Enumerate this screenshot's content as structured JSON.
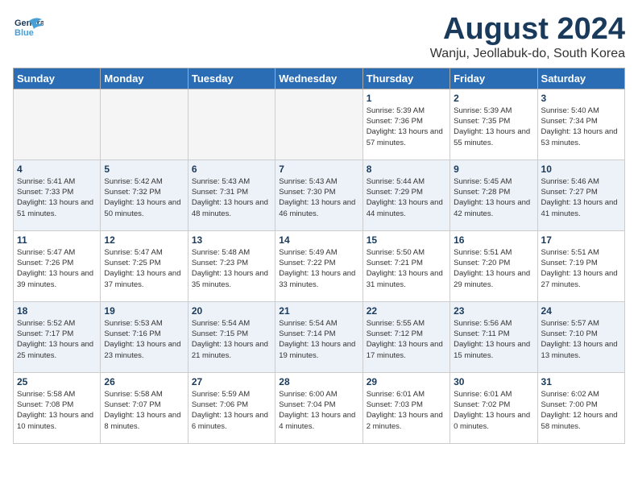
{
  "header": {
    "logo_general": "General",
    "logo_blue": "Blue",
    "month_title": "August 2024",
    "location": "Wanju, Jeollabuk-do, South Korea"
  },
  "weekdays": [
    "Sunday",
    "Monday",
    "Tuesday",
    "Wednesday",
    "Thursday",
    "Friday",
    "Saturday"
  ],
  "weeks": [
    [
      {
        "day": "",
        "empty": true
      },
      {
        "day": "",
        "empty": true
      },
      {
        "day": "",
        "empty": true
      },
      {
        "day": "",
        "empty": true
      },
      {
        "day": "1",
        "sunrise": "Sunrise: 5:39 AM",
        "sunset": "Sunset: 7:36 PM",
        "daylight": "Daylight: 13 hours and 57 minutes."
      },
      {
        "day": "2",
        "sunrise": "Sunrise: 5:39 AM",
        "sunset": "Sunset: 7:35 PM",
        "daylight": "Daylight: 13 hours and 55 minutes."
      },
      {
        "day": "3",
        "sunrise": "Sunrise: 5:40 AM",
        "sunset": "Sunset: 7:34 PM",
        "daylight": "Daylight: 13 hours and 53 minutes."
      }
    ],
    [
      {
        "day": "4",
        "sunrise": "Sunrise: 5:41 AM",
        "sunset": "Sunset: 7:33 PM",
        "daylight": "Daylight: 13 hours and 51 minutes."
      },
      {
        "day": "5",
        "sunrise": "Sunrise: 5:42 AM",
        "sunset": "Sunset: 7:32 PM",
        "daylight": "Daylight: 13 hours and 50 minutes."
      },
      {
        "day": "6",
        "sunrise": "Sunrise: 5:43 AM",
        "sunset": "Sunset: 7:31 PM",
        "daylight": "Daylight: 13 hours and 48 minutes."
      },
      {
        "day": "7",
        "sunrise": "Sunrise: 5:43 AM",
        "sunset": "Sunset: 7:30 PM",
        "daylight": "Daylight: 13 hours and 46 minutes."
      },
      {
        "day": "8",
        "sunrise": "Sunrise: 5:44 AM",
        "sunset": "Sunset: 7:29 PM",
        "daylight": "Daylight: 13 hours and 44 minutes."
      },
      {
        "day": "9",
        "sunrise": "Sunrise: 5:45 AM",
        "sunset": "Sunset: 7:28 PM",
        "daylight": "Daylight: 13 hours and 42 minutes."
      },
      {
        "day": "10",
        "sunrise": "Sunrise: 5:46 AM",
        "sunset": "Sunset: 7:27 PM",
        "daylight": "Daylight: 13 hours and 41 minutes."
      }
    ],
    [
      {
        "day": "11",
        "sunrise": "Sunrise: 5:47 AM",
        "sunset": "Sunset: 7:26 PM",
        "daylight": "Daylight: 13 hours and 39 minutes."
      },
      {
        "day": "12",
        "sunrise": "Sunrise: 5:47 AM",
        "sunset": "Sunset: 7:25 PM",
        "daylight": "Daylight: 13 hours and 37 minutes."
      },
      {
        "day": "13",
        "sunrise": "Sunrise: 5:48 AM",
        "sunset": "Sunset: 7:23 PM",
        "daylight": "Daylight: 13 hours and 35 minutes."
      },
      {
        "day": "14",
        "sunrise": "Sunrise: 5:49 AM",
        "sunset": "Sunset: 7:22 PM",
        "daylight": "Daylight: 13 hours and 33 minutes."
      },
      {
        "day": "15",
        "sunrise": "Sunrise: 5:50 AM",
        "sunset": "Sunset: 7:21 PM",
        "daylight": "Daylight: 13 hours and 31 minutes."
      },
      {
        "day": "16",
        "sunrise": "Sunrise: 5:51 AM",
        "sunset": "Sunset: 7:20 PM",
        "daylight": "Daylight: 13 hours and 29 minutes."
      },
      {
        "day": "17",
        "sunrise": "Sunrise: 5:51 AM",
        "sunset": "Sunset: 7:19 PM",
        "daylight": "Daylight: 13 hours and 27 minutes."
      }
    ],
    [
      {
        "day": "18",
        "sunrise": "Sunrise: 5:52 AM",
        "sunset": "Sunset: 7:17 PM",
        "daylight": "Daylight: 13 hours and 25 minutes."
      },
      {
        "day": "19",
        "sunrise": "Sunrise: 5:53 AM",
        "sunset": "Sunset: 7:16 PM",
        "daylight": "Daylight: 13 hours and 23 minutes."
      },
      {
        "day": "20",
        "sunrise": "Sunrise: 5:54 AM",
        "sunset": "Sunset: 7:15 PM",
        "daylight": "Daylight: 13 hours and 21 minutes."
      },
      {
        "day": "21",
        "sunrise": "Sunrise: 5:54 AM",
        "sunset": "Sunset: 7:14 PM",
        "daylight": "Daylight: 13 hours and 19 minutes."
      },
      {
        "day": "22",
        "sunrise": "Sunrise: 5:55 AM",
        "sunset": "Sunset: 7:12 PM",
        "daylight": "Daylight: 13 hours and 17 minutes."
      },
      {
        "day": "23",
        "sunrise": "Sunrise: 5:56 AM",
        "sunset": "Sunset: 7:11 PM",
        "daylight": "Daylight: 13 hours and 15 minutes."
      },
      {
        "day": "24",
        "sunrise": "Sunrise: 5:57 AM",
        "sunset": "Sunset: 7:10 PM",
        "daylight": "Daylight: 13 hours and 13 minutes."
      }
    ],
    [
      {
        "day": "25",
        "sunrise": "Sunrise: 5:58 AM",
        "sunset": "Sunset: 7:08 PM",
        "daylight": "Daylight: 13 hours and 10 minutes."
      },
      {
        "day": "26",
        "sunrise": "Sunrise: 5:58 AM",
        "sunset": "Sunset: 7:07 PM",
        "daylight": "Daylight: 13 hours and 8 minutes."
      },
      {
        "day": "27",
        "sunrise": "Sunrise: 5:59 AM",
        "sunset": "Sunset: 7:06 PM",
        "daylight": "Daylight: 13 hours and 6 minutes."
      },
      {
        "day": "28",
        "sunrise": "Sunrise: 6:00 AM",
        "sunset": "Sunset: 7:04 PM",
        "daylight": "Daylight: 13 hours and 4 minutes."
      },
      {
        "day": "29",
        "sunrise": "Sunrise: 6:01 AM",
        "sunset": "Sunset: 7:03 PM",
        "daylight": "Daylight: 13 hours and 2 minutes."
      },
      {
        "day": "30",
        "sunrise": "Sunrise: 6:01 AM",
        "sunset": "Sunset: 7:02 PM",
        "daylight": "Daylight: 13 hours and 0 minutes."
      },
      {
        "day": "31",
        "sunrise": "Sunrise: 6:02 AM",
        "sunset": "Sunset: 7:00 PM",
        "daylight": "Daylight: 12 hours and 58 minutes."
      }
    ]
  ]
}
